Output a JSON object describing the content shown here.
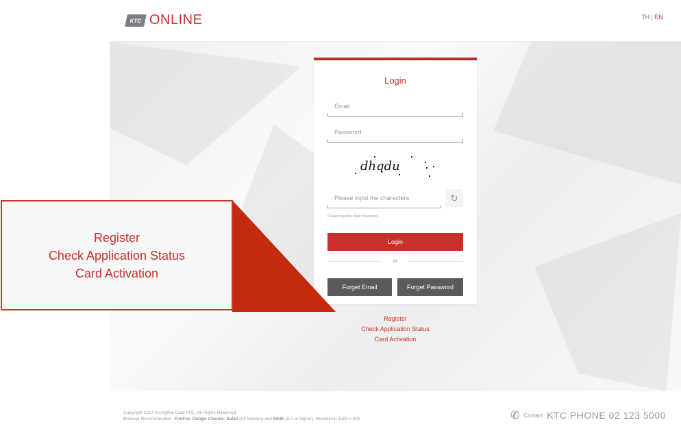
{
  "header": {
    "logo_badge": "KTC",
    "logo_text": "ONLINE",
    "lang_th": "TH",
    "lang_sep": "|",
    "lang_en": "EN"
  },
  "login": {
    "title": "Login",
    "email_placeholder": "Email",
    "password_placeholder": "Password",
    "captcha_text": "dhqdu",
    "captcha_placeholder": "Please input the characters",
    "captcha_hint": "Please input the lower characters",
    "login_button": "Login",
    "or": "or",
    "forget_email_button": "Forget Email",
    "forget_password_button": "Forget Password"
  },
  "links": {
    "register": "Register",
    "check_status": "Check Application Status",
    "card_activation": "Card Activation"
  },
  "callout": {
    "register": "Register",
    "check_status": "Check Application Status",
    "card_activation": "Card Activation"
  },
  "footer": {
    "copyright": "Copyright 2014 Krungthai Card PCL. All Rights Reserved.",
    "browser_prefix": "Browser Recommended :",
    "browsers": [
      "FireFox",
      "Google Chrome",
      "Safari",
      "MSIE"
    ],
    "browser_text_1": ",",
    "browser_text_2": ",",
    "browser_text_3": "(All Version) and",
    "browser_text_4": "(9.0 or higher), Resolution 1200 x 800",
    "contact_label": "Contact",
    "contact_phone": "KTC PHONE 02 123 5000"
  },
  "colors": {
    "brand_red": "#c9302c",
    "button_grey": "#5a5a5a"
  },
  "icons": {
    "phone": "phone-icon",
    "refresh": "refresh-icon"
  }
}
